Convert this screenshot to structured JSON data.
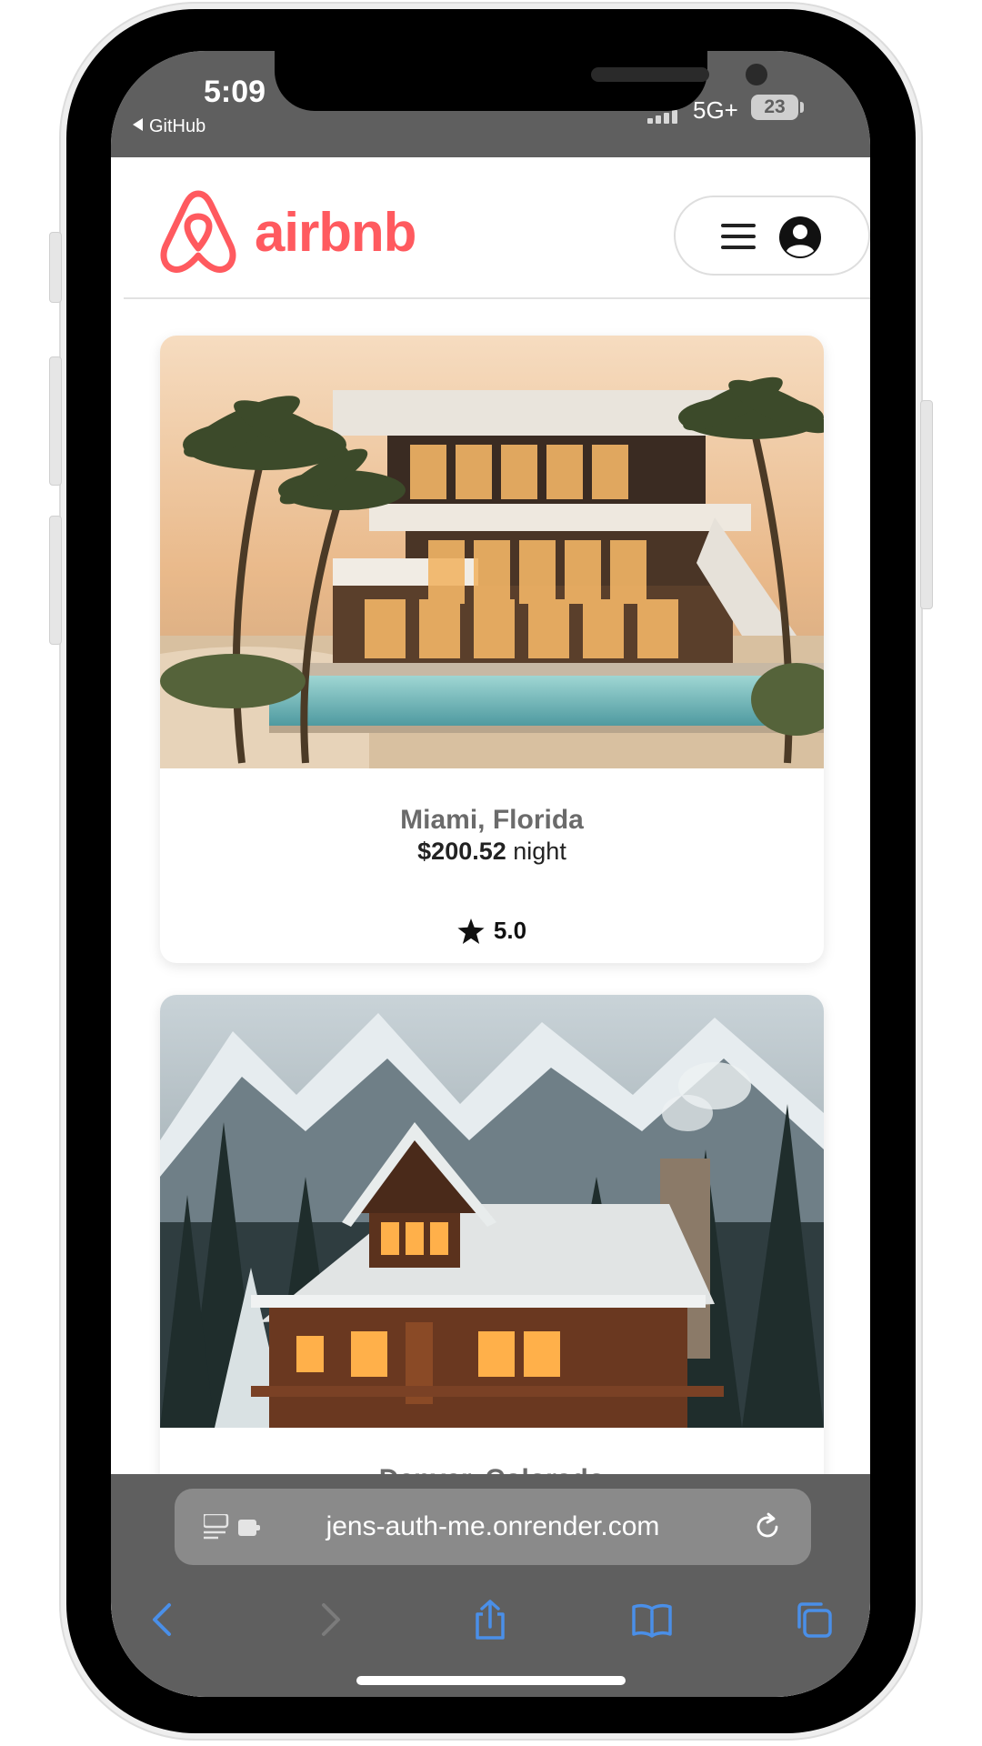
{
  "colors": {
    "brand": "#ff5a5f",
    "safari_chrome": "#5f5f5f",
    "safari_accent": "#4a8fe8"
  },
  "status_bar": {
    "time": "5:09",
    "back_app": "GitHub",
    "network": "5G+",
    "battery": "23"
  },
  "header": {
    "brand_name": "airbnb",
    "logo_icon": "airbnb-belo-icon",
    "menu_icon": "hamburger-icon",
    "profile_icon": "user-circle-icon"
  },
  "listings": [
    {
      "city": "Miami, Florida",
      "price": "$200.52",
      "price_unit": "night",
      "rating": "5.0",
      "rating_icon": "star-icon",
      "photo": "modern-beach-villa-with-pool"
    },
    {
      "city": "Denver, Colorado",
      "photo": "snowy-mountain-log-cabin"
    }
  ],
  "browser": {
    "url": "jens-auth-me.onrender.com",
    "reader_icon": "reader-extension-icon",
    "reload_icon": "reload-icon",
    "nav_icons": [
      "back-icon",
      "forward-icon",
      "share-icon",
      "bookmarks-icon",
      "tabs-icon"
    ]
  }
}
